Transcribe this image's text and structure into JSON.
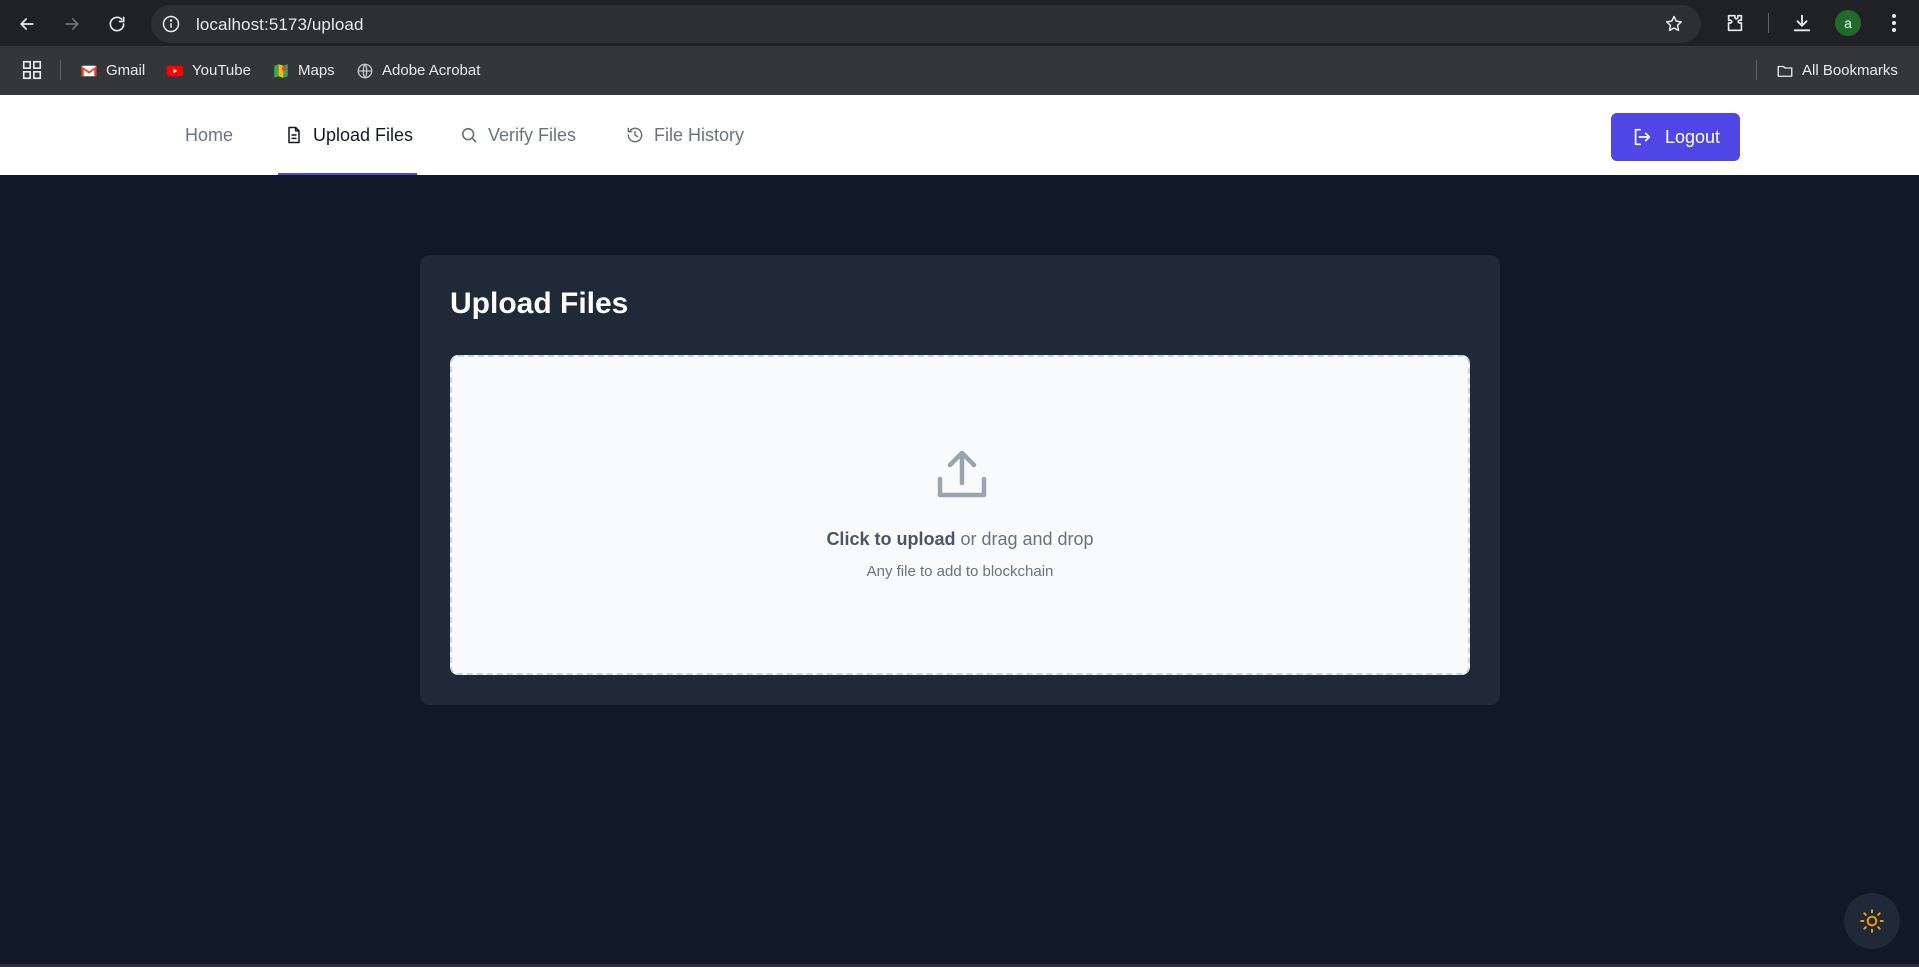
{
  "browser": {
    "url": "localhost:5173/upload",
    "bookmarks": [
      {
        "label": "Gmail",
        "icon": "gmail-icon"
      },
      {
        "label": "YouTube",
        "icon": "youtube-icon"
      },
      {
        "label": "Maps",
        "icon": "maps-icon"
      },
      {
        "label": "Adobe Acrobat",
        "icon": "globe-icon"
      }
    ],
    "all_bookmarks": "All Bookmarks",
    "profile_initial": "a"
  },
  "nav": {
    "items": [
      {
        "label": "Home",
        "icon": ""
      },
      {
        "label": "Upload Files",
        "icon": "document-icon",
        "active": true
      },
      {
        "label": "Verify Files",
        "icon": "search-icon"
      },
      {
        "label": "File History",
        "icon": "history-icon"
      }
    ],
    "logout_label": "Logout"
  },
  "upload": {
    "title": "Upload Files",
    "click_text": "Click to upload",
    "drag_text": " or drag and drop",
    "hint": "Any file to add to blockchain"
  },
  "colors": {
    "accent": "#4f46e5",
    "page_bg": "#111827",
    "card_bg": "#1f2937",
    "sun": "#f59e0b"
  }
}
